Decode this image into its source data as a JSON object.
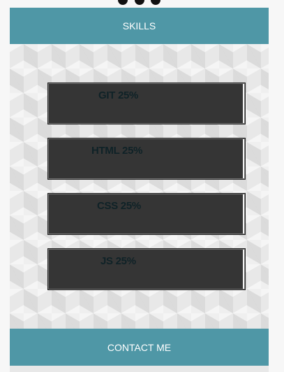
{
  "header": {
    "title": "SKILLS"
  },
  "skills": [
    {
      "label": "GIT 25%",
      "level": 0.99
    },
    {
      "label": "HTML 25%",
      "level": 0.99
    },
    {
      "label": "CSS 25%",
      "level": 0.99
    },
    {
      "label": "JS 25%",
      "level": 0.99
    }
  ],
  "footer": {
    "contact_label": "CONTACT ME"
  },
  "colors": {
    "header_bg": "#4f97a6",
    "bar_fill": "#353535",
    "label_text": "#0f2227"
  }
}
